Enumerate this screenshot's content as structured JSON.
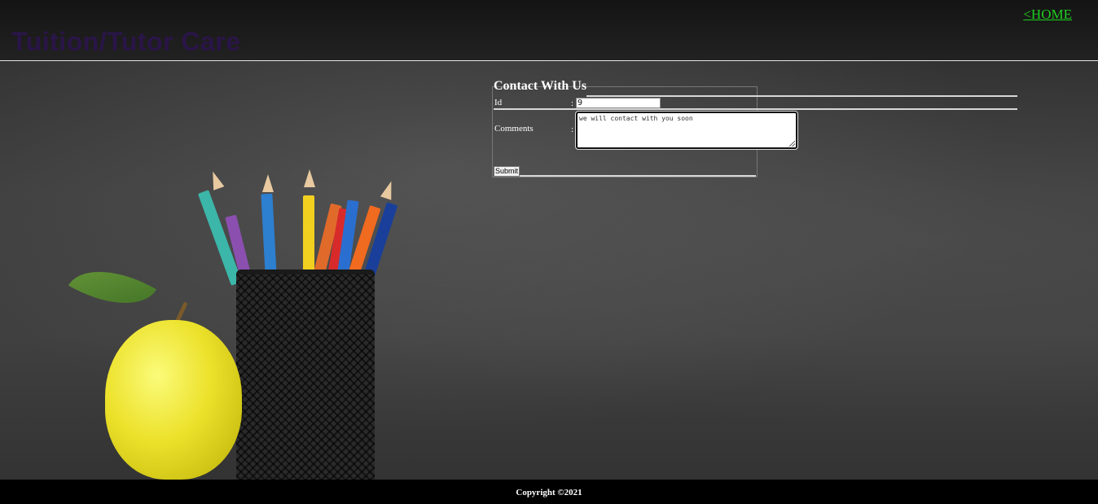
{
  "header": {
    "site_title": "Tuition/Tutor Care",
    "home_link": "<HOME"
  },
  "form": {
    "title": "Contact With Us",
    "id_label": "Id",
    "id_value": "9",
    "comments_label": "Comments",
    "colon": ":",
    "comments_value": "we will contact with you soon",
    "submit_label": "Submit"
  },
  "footer": {
    "copyright": "Copyright ©2021"
  },
  "colors": {
    "home_link": "#1fd01f",
    "site_title": "#2a1548",
    "footer_bg": "#000000"
  },
  "illustration": {
    "items": [
      "apple",
      "pencil-cup",
      "colored-pencils"
    ]
  }
}
